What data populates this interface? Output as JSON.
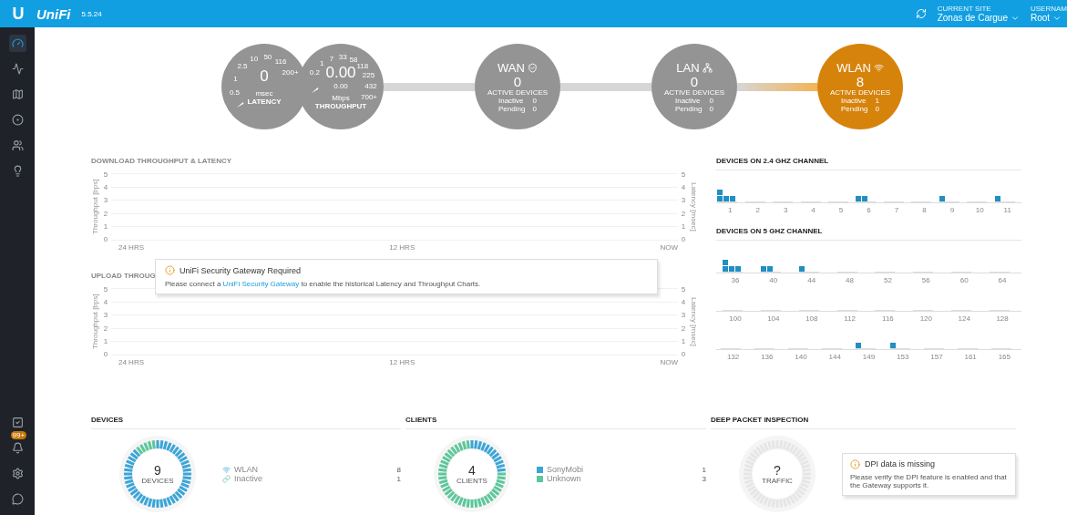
{
  "topbar": {
    "logo": "U",
    "brand": "UniFi",
    "version": "5.5.24",
    "site_label": "CURRENT SITE",
    "site": "Zonas de Cargue",
    "user_label": "USERNAM",
    "user": "Root"
  },
  "sidebar": {
    "items": [
      {
        "kind": "dashboard",
        "selected": true
      },
      {
        "kind": "statistics",
        "selected": false
      },
      {
        "kind": "map",
        "selected": false
      },
      {
        "kind": "devices",
        "selected": false
      },
      {
        "kind": "clients",
        "selected": false
      },
      {
        "kind": "insights",
        "selected": false
      }
    ],
    "bottom_items": [
      {
        "kind": "tasks"
      },
      {
        "kind": "alerts",
        "badge": "99+"
      },
      {
        "kind": "settings"
      },
      {
        "kind": "chat"
      }
    ]
  },
  "gauges": [
    {
      "value": "0",
      "unit": "msec",
      "label": "LATENCY",
      "ticks": [
        "0.5",
        "1",
        "2.5",
        "10",
        "50",
        "116",
        "200+"
      ]
    },
    {
      "value": "0.00",
      "sub_value": "0.00",
      "unit": "Mbps",
      "label": "THROUGHPUT",
      "ticks": [
        "0.2",
        "1",
        "7",
        "33",
        "58",
        "118",
        "225",
        "432",
        "700+"
      ]
    }
  ],
  "networks": [
    {
      "kind": "wan",
      "title": "WAN",
      "count": "0",
      "caption": "ACTIVE DEVICES",
      "selected": false,
      "stats": [
        {
          "label": "Inactive",
          "value": "0"
        },
        {
          "label": "Pending",
          "value": "0"
        }
      ]
    },
    {
      "kind": "lan",
      "title": "LAN",
      "count": "0",
      "caption": "ACTIVE DEVICES",
      "selected": false,
      "stats": [
        {
          "label": "Inactive",
          "value": "0"
        },
        {
          "label": "Pending",
          "value": "0"
        }
      ]
    },
    {
      "kind": "wlan",
      "title": "WLAN",
      "count": "8",
      "caption": "ACTIVE DEVICES",
      "selected": true,
      "stats": [
        {
          "label": "Inactive",
          "value": "1"
        },
        {
          "label": "Pending",
          "value": "0"
        }
      ]
    }
  ],
  "traffic_charts": [
    {
      "title": "DOWNLOAD THROUGHPUT & LATENCY",
      "left_axis": "Throughput [bps]",
      "right_axis": "Latency [msec]",
      "left_ticks": [
        "5",
        "4",
        "3",
        "2",
        "1",
        "0"
      ],
      "right_ticks": [
        "5",
        "4",
        "3",
        "2",
        "1",
        "0"
      ],
      "xlabels": [
        "24 HRS",
        "12 HRS",
        "NOW"
      ]
    },
    {
      "title": "UPLOAD THROUG",
      "left_axis": "Throughput [bps]",
      "right_axis": "Latency [msec]",
      "left_ticks": [
        "5",
        "4",
        "3",
        "2",
        "1",
        "0"
      ],
      "right_ticks": [
        "5",
        "4",
        "3",
        "2",
        "1",
        "0"
      ],
      "xlabels": [
        "24 HRS",
        "12 HRS",
        "NOW"
      ]
    }
  ],
  "gateway_notice": {
    "title": "UniFi Security Gateway Required",
    "text_before": "Please connect a",
    "link": "UniFi Security Gateway",
    "text_after": "to enable the historical Latency and Throughput Charts."
  },
  "channel_panels": [
    {
      "title": "DEVICES ON 2.4 GHZ CHANNEL",
      "rows": [
        [
          {
            "label": "1",
            "devices": [
              {
                "kind": "client"
              },
              {
                "kind": "client"
              },
              {
                "kind": "client"
              },
              {
                "kind": "client"
              }
            ]
          },
          {
            "label": "2"
          },
          {
            "label": "3"
          },
          {
            "label": "4"
          },
          {
            "label": "5"
          },
          {
            "label": "6",
            "devices": [
              {
                "kind": "client"
              },
              {
                "kind": "client"
              }
            ]
          },
          {
            "label": "7"
          },
          {
            "label": "8"
          },
          {
            "label": "9",
            "devices": [
              {
                "kind": "client"
              }
            ]
          },
          {
            "label": "10"
          },
          {
            "label": "11",
            "devices": [
              {
                "kind": "client"
              }
            ]
          }
        ]
      ]
    },
    {
      "title": "DEVICES ON 5 GHZ CHANNEL",
      "rows": [
        [
          {
            "label": "36",
            "devices": [
              {
                "kind": "client"
              },
              {
                "kind": "client"
              },
              {
                "kind": "client"
              },
              {
                "kind": "client"
              }
            ]
          },
          {
            "label": "40",
            "devices": [
              {
                "kind": "client"
              },
              {
                "kind": "client"
              }
            ]
          },
          {
            "label": "44",
            "devices": [
              {
                "kind": "client"
              }
            ]
          },
          {
            "label": "48"
          },
          {
            "label": "52"
          },
          {
            "label": "56"
          },
          {
            "label": "60"
          },
          {
            "label": "64"
          }
        ],
        [
          {
            "label": "100"
          },
          {
            "label": "104"
          },
          {
            "label": "108"
          },
          {
            "label": "112"
          },
          {
            "label": "116"
          },
          {
            "label": "120"
          },
          {
            "label": "124"
          },
          {
            "label": "128"
          }
        ],
        [
          {
            "label": "132"
          },
          {
            "label": "136"
          },
          {
            "label": "140"
          },
          {
            "label": "144"
          },
          {
            "label": "149",
            "devices": [
              {
                "kind": "client"
              }
            ]
          },
          {
            "label": "153",
            "devices": [
              {
                "kind": "client"
              }
            ]
          },
          {
            "label": "157"
          },
          {
            "label": "161"
          },
          {
            "label": "165"
          }
        ]
      ]
    }
  ],
  "devices": {
    "title": "DEVICES",
    "total": "9",
    "caption": "DEVICES",
    "legend": [
      {
        "kind": "wifi",
        "label": "WLAN",
        "value": "8",
        "color": "#3aa5d8"
      },
      {
        "kind": "link",
        "label": "Inactive",
        "value": "1",
        "color": "#5cc79a"
      }
    ]
  },
  "clients": {
    "title": "CLIENTS",
    "total": "4",
    "caption": "CLIENTS",
    "legend": [
      {
        "kind": "square",
        "label": "SonyMobi",
        "value": "1",
        "color": "#3aa5d8"
      },
      {
        "kind": "square",
        "label": "Unknown",
        "value": "3",
        "color": "#5cc79a"
      }
    ]
  },
  "dpi": {
    "title": "DEEP PACKET INSPECTION",
    "total": "?",
    "caption": "TRAFFIC",
    "notice_title": "DPI data is missing",
    "notice_text": "Please verify the DPI feature is enabled and that the Gateway supports it."
  }
}
